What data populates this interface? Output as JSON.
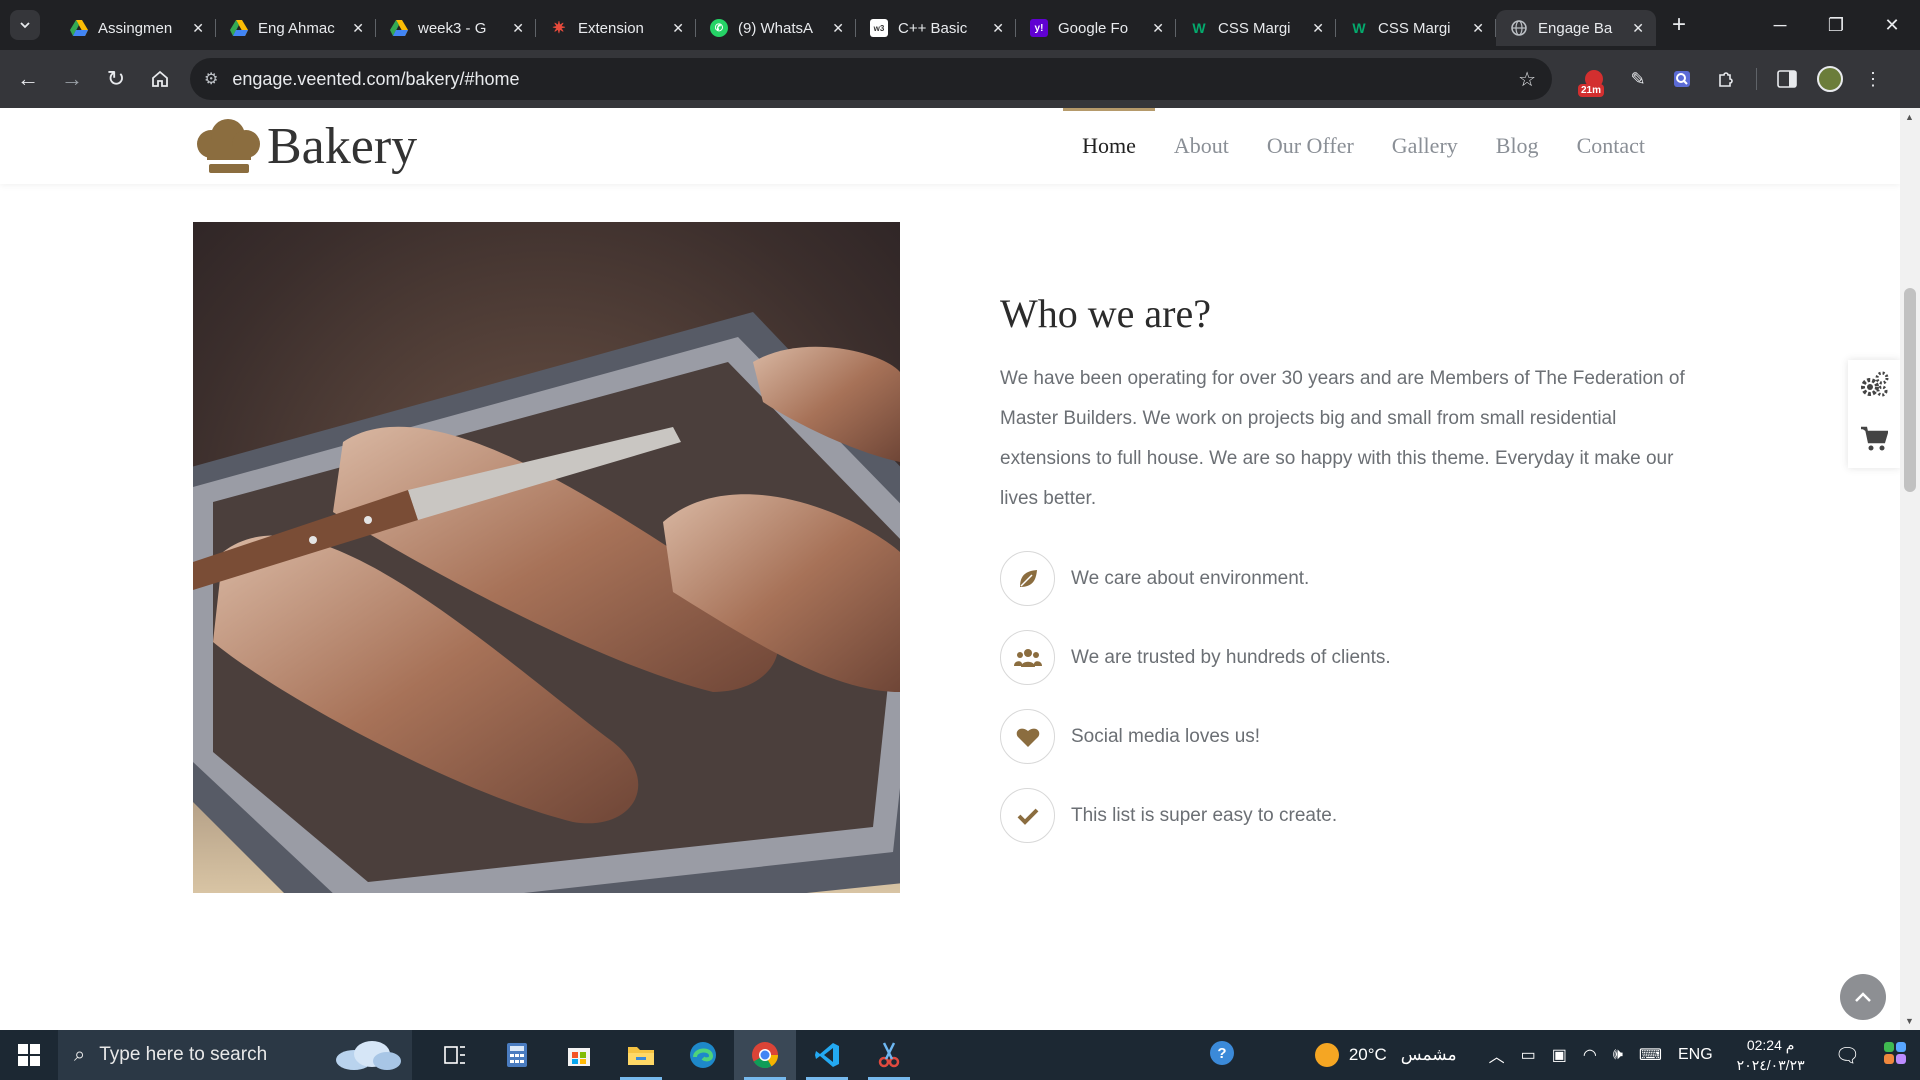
{
  "browser": {
    "tabs": [
      {
        "title": "Assingmen",
        "favicon": "google-drive-icon",
        "active": false
      },
      {
        "title": "Eng Ahmac",
        "favicon": "google-drive-icon",
        "active": false
      },
      {
        "title": "week3 - G",
        "favicon": "google-drive-icon",
        "active": false
      },
      {
        "title": "Extension",
        "favicon": "extension-star-icon",
        "active": false
      },
      {
        "title": "(9) WhatsA",
        "favicon": "whatsapp-icon",
        "active": false
      },
      {
        "title": "C++ Basic",
        "favicon": "w3schools-icon",
        "active": false
      },
      {
        "title": "Google Fo",
        "favicon": "yahoo-icon",
        "active": false
      },
      {
        "title": "CSS Margi",
        "favicon": "w-green-icon",
        "active": false
      },
      {
        "title": "CSS Margi",
        "favicon": "w-green-icon",
        "active": false
      },
      {
        "title": "Engage Ba",
        "favicon": "globe-icon",
        "active": true
      }
    ],
    "url": "engage.veented.com/bakery/#home",
    "extension_badge": "21m"
  },
  "site": {
    "logo_text": "Bakery",
    "menu": [
      {
        "label": "Home",
        "active": true
      },
      {
        "label": "About",
        "active": false
      },
      {
        "label": "Our Offer",
        "active": false
      },
      {
        "label": "Gallery",
        "active": false
      },
      {
        "label": "Blog",
        "active": false
      },
      {
        "label": "Contact",
        "active": false
      }
    ],
    "section": {
      "heading": "Who we are?",
      "paragraph": "We have been operating for over 30 years and are Members of The Federation of Master Builders. We work on projects big and small from small residential extensions to full house. We are so happy with this theme. Everyday it make our lives better.",
      "features": [
        {
          "icon": "leaf-icon",
          "label": "We care about environment."
        },
        {
          "icon": "users-icon",
          "label": "We are trusted by hundreds of clients."
        },
        {
          "icon": "heart-icon",
          "label": "Social media loves us!"
        },
        {
          "icon": "check-icon",
          "label": "This list is super easy to create."
        }
      ]
    },
    "accent_color": "#8b6d3f"
  },
  "taskbar": {
    "search_placeholder": "Type here to search",
    "weather_temp": "20°C",
    "weather_desc": "مشمس",
    "language": "ENG",
    "time": "02:24 م",
    "date": "٢٠٢٤/٠٣/٢٣"
  }
}
